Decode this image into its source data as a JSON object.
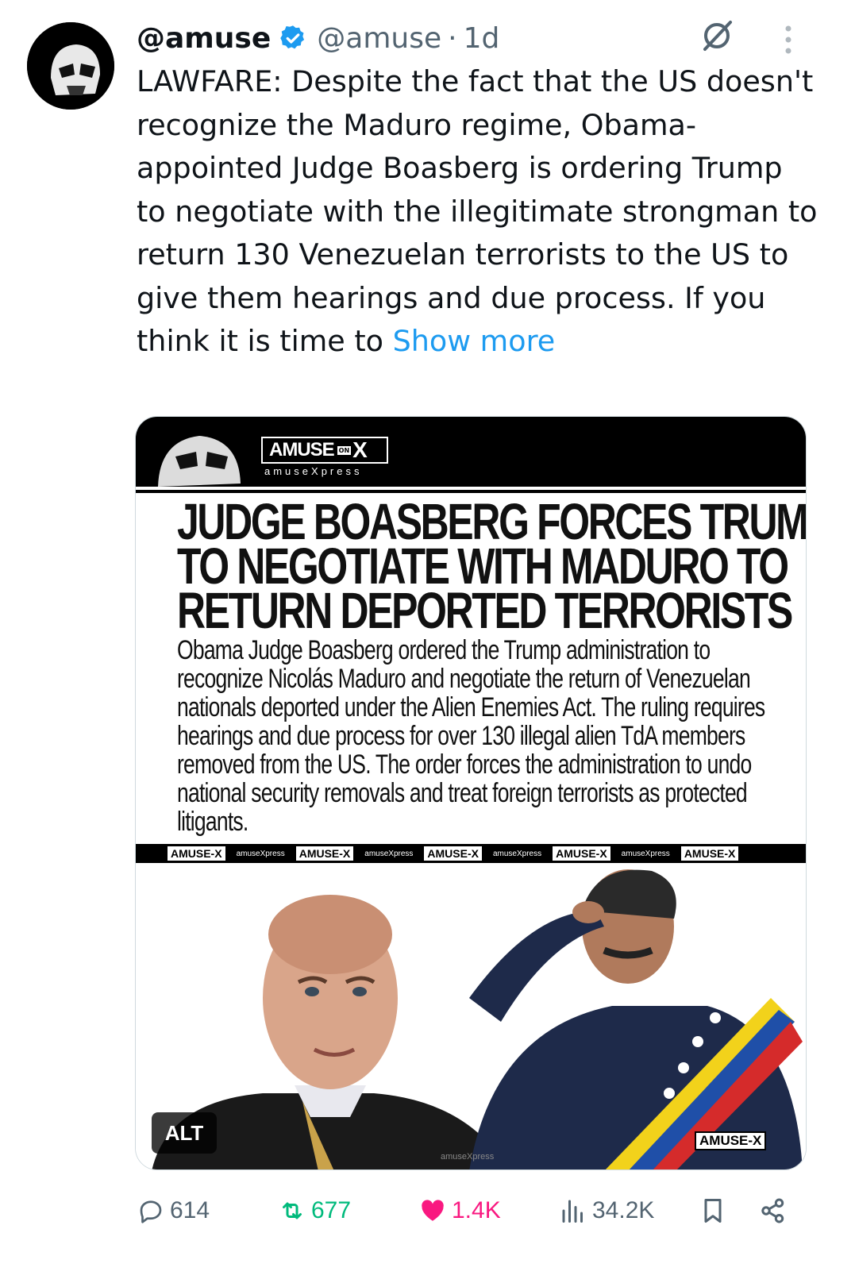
{
  "tweet": {
    "display_name": "@amuse",
    "handle": "@amuse",
    "separator": "·",
    "time": "1d",
    "text": "LAWFARE: Despite the fact that the US doesn't recognize the Maduro regime, Obama-appointed Judge Boasberg is ordering Trump to negotiate with the illegitimate strongman to return 130 Venezuelan terrorists to the US to give them hearings and due process. If you think it is time to ",
    "show_more": "Show more"
  },
  "media": {
    "brand": "AMUSE",
    "brand_on": "ON",
    "brand_x": "X",
    "brand_sub": "amuseXpress",
    "headline_1": "JUDGE BOASBERG FORCES TRUMP",
    "headline_2": "TO NEGOTIATE WITH MADURO TO",
    "headline_3": "RETURN DEPORTED TERRORISTS",
    "body": "Obama Judge Boasberg ordered the Trump administration to recognize Nicolás Maduro and negotiate the return of Venezuelan nationals deported under the Alien Enemies Act. The ruling requires hearings and due process for over 130 illegal alien TdA members removed from the US. The order forces the administration to undo national security removals and treat foreign terrorists as protected litigants.",
    "ribbon_logo": "AMUSE-X",
    "ribbon_sub": "amuseXpress",
    "alt": "ALT",
    "watermark": "amuseXpress",
    "corner_logo": "AMUSE-X"
  },
  "actions": {
    "replies": "614",
    "reposts": "677",
    "likes": "1.4K",
    "views": "34.2K"
  },
  "colors": {
    "link": "#1d9bf0",
    "like": "#f91880",
    "repost": "#00ba7c",
    "muted": "#536471",
    "verified": "#1d9bf0"
  }
}
